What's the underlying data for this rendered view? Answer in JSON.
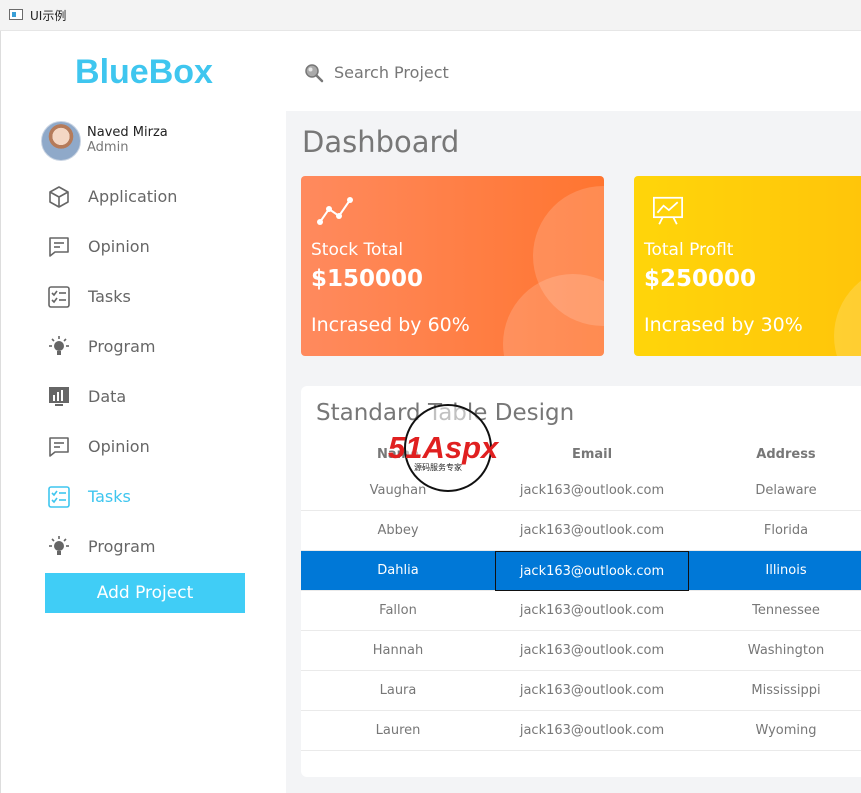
{
  "window": {
    "title": "UI示例"
  },
  "brand": {
    "name": "BlueBox",
    "color": "#3fc6ef"
  },
  "user": {
    "name": "Naved Mirza",
    "role": "Admin"
  },
  "sidebar": {
    "items": [
      {
        "label": "Application",
        "icon": "cube-icon",
        "active": false
      },
      {
        "label": "Opinion",
        "icon": "message-icon",
        "active": false
      },
      {
        "label": "Tasks",
        "icon": "checklist-icon",
        "active": false
      },
      {
        "label": "Program",
        "icon": "lightbulb-icon",
        "active": false
      },
      {
        "label": "Data",
        "icon": "bar-chart-icon",
        "active": false
      },
      {
        "label": "Opinion",
        "icon": "message-icon",
        "active": false
      },
      {
        "label": "Tasks",
        "icon": "checklist-icon",
        "active": true
      },
      {
        "label": "Program",
        "icon": "lightbulb-icon",
        "active": false
      }
    ],
    "add_button": "Add Project"
  },
  "search": {
    "placeholder": "Search Project",
    "icon": "search-icon"
  },
  "dashboard": {
    "title": "Dashboard",
    "cards": [
      {
        "label": "Stock Total",
        "value": "$150000",
        "footer": "Incrased by 60%",
        "icon": "trend-icon",
        "color": "#ff7a3d"
      },
      {
        "label": "Total Proflt",
        "value": "$250000",
        "footer": "Incrased by 30%",
        "icon": "presentation-icon",
        "color": "#ffcb0a"
      }
    ]
  },
  "table": {
    "title": "Standard Table Design",
    "columns": [
      "Name",
      "Email",
      "Address"
    ],
    "rows": [
      {
        "name": "Vaughan",
        "email": "jack163@outlook.com",
        "address": "Delaware"
      },
      {
        "name": "Abbey",
        "email": "jack163@outlook.com",
        "address": "Florida"
      },
      {
        "name": "Dahlia",
        "email": "jack163@outlook.com",
        "address": "Illinois"
      },
      {
        "name": "Fallon",
        "email": "jack163@outlook.com",
        "address": "Tennessee"
      },
      {
        "name": "Hannah",
        "email": "jack163@outlook.com",
        "address": "Washington"
      },
      {
        "name": "Laura",
        "email": "jack163@outlook.com",
        "address": "Mississippi"
      },
      {
        "name": "Lauren",
        "email": "jack163@outlook.com",
        "address": "Wyoming"
      }
    ],
    "selected_row": 2,
    "selected_color": "#0078d7"
  },
  "watermark": {
    "text": "51Aspx",
    "subtext": "源码服务专家"
  }
}
